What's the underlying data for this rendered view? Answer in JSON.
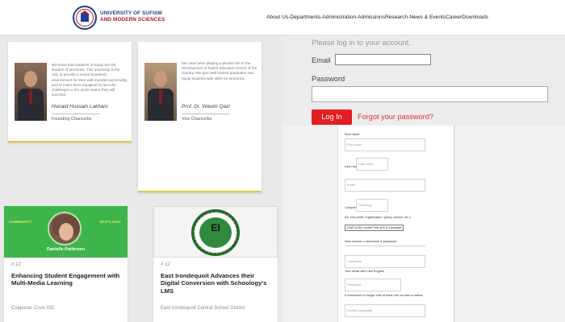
{
  "header": {
    "university_line1": "UNIVERSITY OF SUFISM",
    "university_line2": "AND MODERN SCIENCES",
    "nav": [
      "About Us",
      " - ",
      "Departments",
      " - ",
      "Administration",
      " - ",
      "Admissions",
      "Research",
      " - ",
      "News & Events",
      "Career",
      "Downloads"
    ]
  },
  "chancellors": [
    {
      "quote": "We know that students of today are the leaders of tomorrow. This university is the only to provide a sound academic environment for their well-rounded personality and to make them equipped to face the challenges in the world where they will succeed.",
      "name": "Hunaid Hussain Lakhani",
      "role": "Founding Chancellor"
    },
    {
      "quote": "We have been playing a pivotal role in the development of higher education sector of the country. We give well trained graduates and equip students with skills for tomorrow.",
      "name": "Prof. Dr. Wasim Qazi",
      "role": "Vice Chancellor"
    }
  ],
  "articles": [
    {
      "tag_left": "COMMUNITY",
      "tag_right": "SPOTLIGHT",
      "caption": "Danielle Patterson",
      "number": "# 12",
      "title": "Enhancing Student Engagement with Multi-Media Learning",
      "source": "Copperas Cove ISD"
    },
    {
      "seal_letters": "EI",
      "number": "# 12",
      "title": "East Irondequoit Advances their Digital Conversion with Schoology's LMS",
      "source": "East Irondequoit Central School District"
    }
  ],
  "login": {
    "hint": "Please log in to your account.",
    "email_label": "Email",
    "password_label": "Password",
    "button": "Log In",
    "forgot": "Forgot your password?"
  },
  "register": {
    "first_name_label": "First name",
    "first_name_placeholder": "First name",
    "last_name_label": "Last name",
    "last_name_placeholder": "Last name",
    "email_placeholder": "Email",
    "company_label": "Company",
    "company_placeholder": "Company",
    "company_hint": "(Or non-profit, organization, group, school, etc.)",
    "timezone_value": "(GMT-6:00) Central Time (US & Canada)",
    "username_heading": "Now choose a username & password",
    "username_placeholder": "Username",
    "username_hint": "Your email can't use Engrish",
    "password_placeholder": "Password",
    "password_hint": "6 characters or longer with at least one number is safest",
    "confirm_placeholder": "Confirm password"
  }
}
